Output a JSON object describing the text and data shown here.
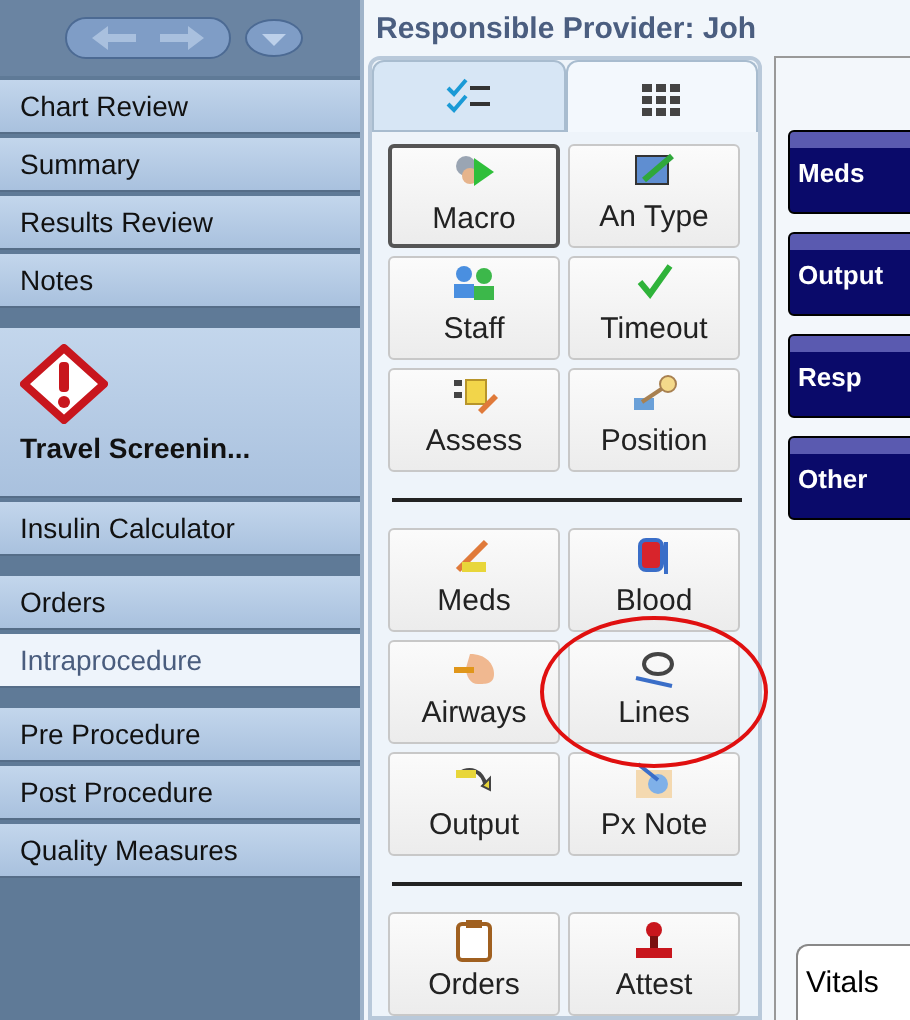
{
  "sidebar": {
    "groups": [
      {
        "items": [
          {
            "kind": "item",
            "label": "Chart Review",
            "selected": false
          },
          {
            "kind": "item",
            "label": "Summary",
            "selected": false
          },
          {
            "kind": "item",
            "label": "Results Review",
            "selected": false
          },
          {
            "kind": "item",
            "label": "Notes",
            "selected": false
          }
        ]
      },
      {
        "items": [
          {
            "kind": "alert",
            "label": "Travel Screenin...",
            "selected": false
          },
          {
            "kind": "item",
            "label": "Insulin Calculator",
            "selected": false
          }
        ]
      },
      {
        "items": [
          {
            "kind": "item",
            "label": "Orders",
            "selected": false
          },
          {
            "kind": "item",
            "label": "Intraprocedure",
            "selected": true
          }
        ]
      },
      {
        "items": [
          {
            "kind": "item",
            "label": "Pre Procedure",
            "selected": false
          },
          {
            "kind": "item",
            "label": "Post Procedure",
            "selected": false
          },
          {
            "kind": "item",
            "label": "Quality Measures",
            "selected": false
          }
        ]
      }
    ]
  },
  "header": {
    "title": "Responsible Provider: Joh"
  },
  "tabs": [
    {
      "selected": false
    },
    {
      "selected": true
    }
  ],
  "button_groups": [
    {
      "buttons": [
        {
          "label": "Macro",
          "default": true,
          "highlighted": false
        },
        {
          "label": "An Type",
          "default": false,
          "highlighted": false
        },
        {
          "label": "Staff",
          "default": false,
          "highlighted": false
        },
        {
          "label": "Timeout",
          "default": false,
          "highlighted": false
        },
        {
          "label": "Assess",
          "default": false,
          "highlighted": false
        },
        {
          "label": "Position",
          "default": false,
          "highlighted": false
        }
      ]
    },
    {
      "buttons": [
        {
          "label": "Meds",
          "default": false,
          "highlighted": false
        },
        {
          "label": "Blood",
          "default": false,
          "highlighted": false
        },
        {
          "label": "Airways",
          "default": false,
          "highlighted": false
        },
        {
          "label": "Lines",
          "default": false,
          "highlighted": true
        },
        {
          "label": "Output",
          "default": false,
          "highlighted": false
        },
        {
          "label": "Px Note",
          "default": false,
          "highlighted": false
        }
      ]
    },
    {
      "buttons": [
        {
          "label": "Orders",
          "default": false,
          "highlighted": false
        },
        {
          "label": "Attest",
          "default": false,
          "highlighted": false
        }
      ]
    }
  ],
  "flowsheet_buttons": [
    "Meds",
    "Output",
    "Resp",
    "Other"
  ],
  "bottom_tab": {
    "label": "Vitals"
  }
}
